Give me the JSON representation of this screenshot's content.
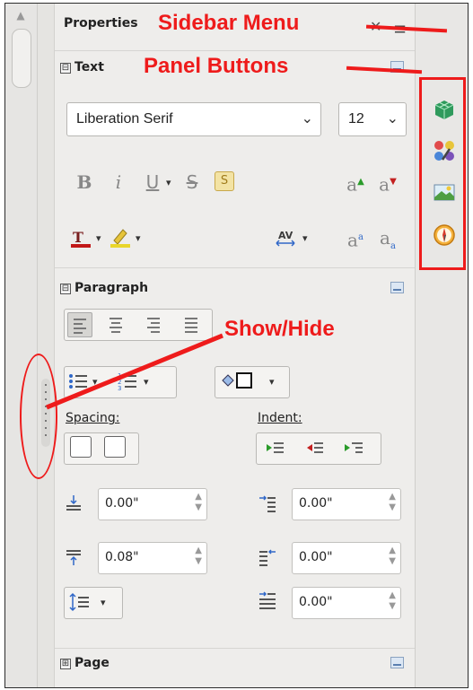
{
  "deck": {
    "title": "Properties",
    "close_glyph": "✕",
    "menu_glyph": "≡"
  },
  "text_panel": {
    "title": "Text",
    "expander": "⊟",
    "font_name": "Liberation Serif",
    "font_size": "12",
    "bold": "B",
    "italic": "i",
    "underline": "U",
    "strike": "S",
    "shadow": "S",
    "superscript": "a",
    "subscript": "a"
  },
  "paragraph_panel": {
    "title": "Paragraph",
    "expander": "⊟",
    "spacing_label": "Spacing:",
    "indent_label": "Indent:",
    "above_spacing": "0.00\"",
    "below_spacing": "0.08\"",
    "before_indent": "0.00\"",
    "after_indent": "0.00\"",
    "first_line_indent": "0.00\""
  },
  "page_panel": {
    "title": "Page",
    "expander": "⊞"
  },
  "annotations": {
    "sidebar_menu": "Sidebar Menu",
    "panel_buttons": "Panel Buttons",
    "show_hide": "Show/Hide"
  },
  "colors": {
    "annotation_red": "#ee1b1b",
    "panel_bg": "#eeedeb"
  },
  "icons": [
    "scroll-up-icon",
    "properties-icon",
    "styles-icon",
    "gallery-icon",
    "navigator-icon"
  ]
}
